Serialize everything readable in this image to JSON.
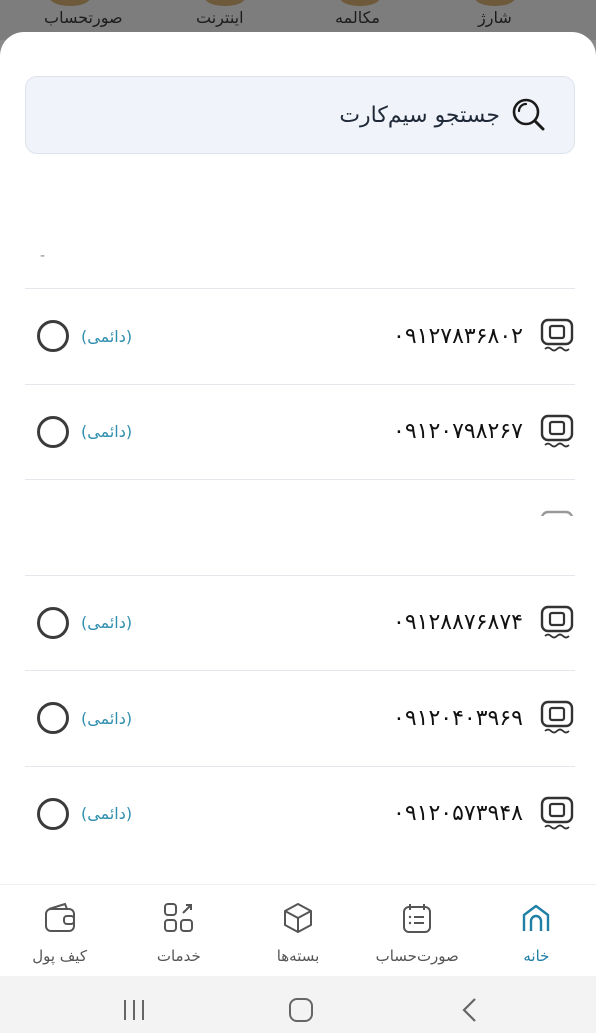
{
  "top_menu": {
    "items": [
      "صورتحساب",
      "اینترنت",
      "مکالمه",
      "شارژ"
    ]
  },
  "search": {
    "placeholder": "جستجو سیم‌کارت"
  },
  "faded_text": "-",
  "sim_list": [
    {
      "number": "۰۹۱۲۷۸۳۶۸۰۲",
      "status": "(دائمی)"
    },
    {
      "number": "۰۹۱۲۰۷۹۸۲۶۷",
      "status": "(دائمی)"
    },
    {
      "number": "",
      "status": ""
    },
    {
      "number": "۰۹۱۲۸۸۷۶۸۷۴",
      "status": "(دائمی)"
    },
    {
      "number": "۰۹۱۲۰۴۰۳۹۶۹",
      "status": "(دائمی)"
    },
    {
      "number": "۰۹۱۲۰۵۷۳۹۴۸",
      "status": "(دائمی)"
    }
  ],
  "bottom_nav": {
    "items": [
      {
        "label": "خانه",
        "icon": "home-icon",
        "active": true
      },
      {
        "label": "صورت‌حساب",
        "icon": "bill-icon",
        "active": false
      },
      {
        "label": "بسته‌ها",
        "icon": "package-icon",
        "active": false
      },
      {
        "label": "خدمات",
        "icon": "services-icon",
        "active": false
      },
      {
        "label": "کیف پول",
        "icon": "wallet-icon",
        "active": false
      }
    ]
  },
  "colors": {
    "accent": "#1f7fa6",
    "status_text": "#2f8fae"
  }
}
